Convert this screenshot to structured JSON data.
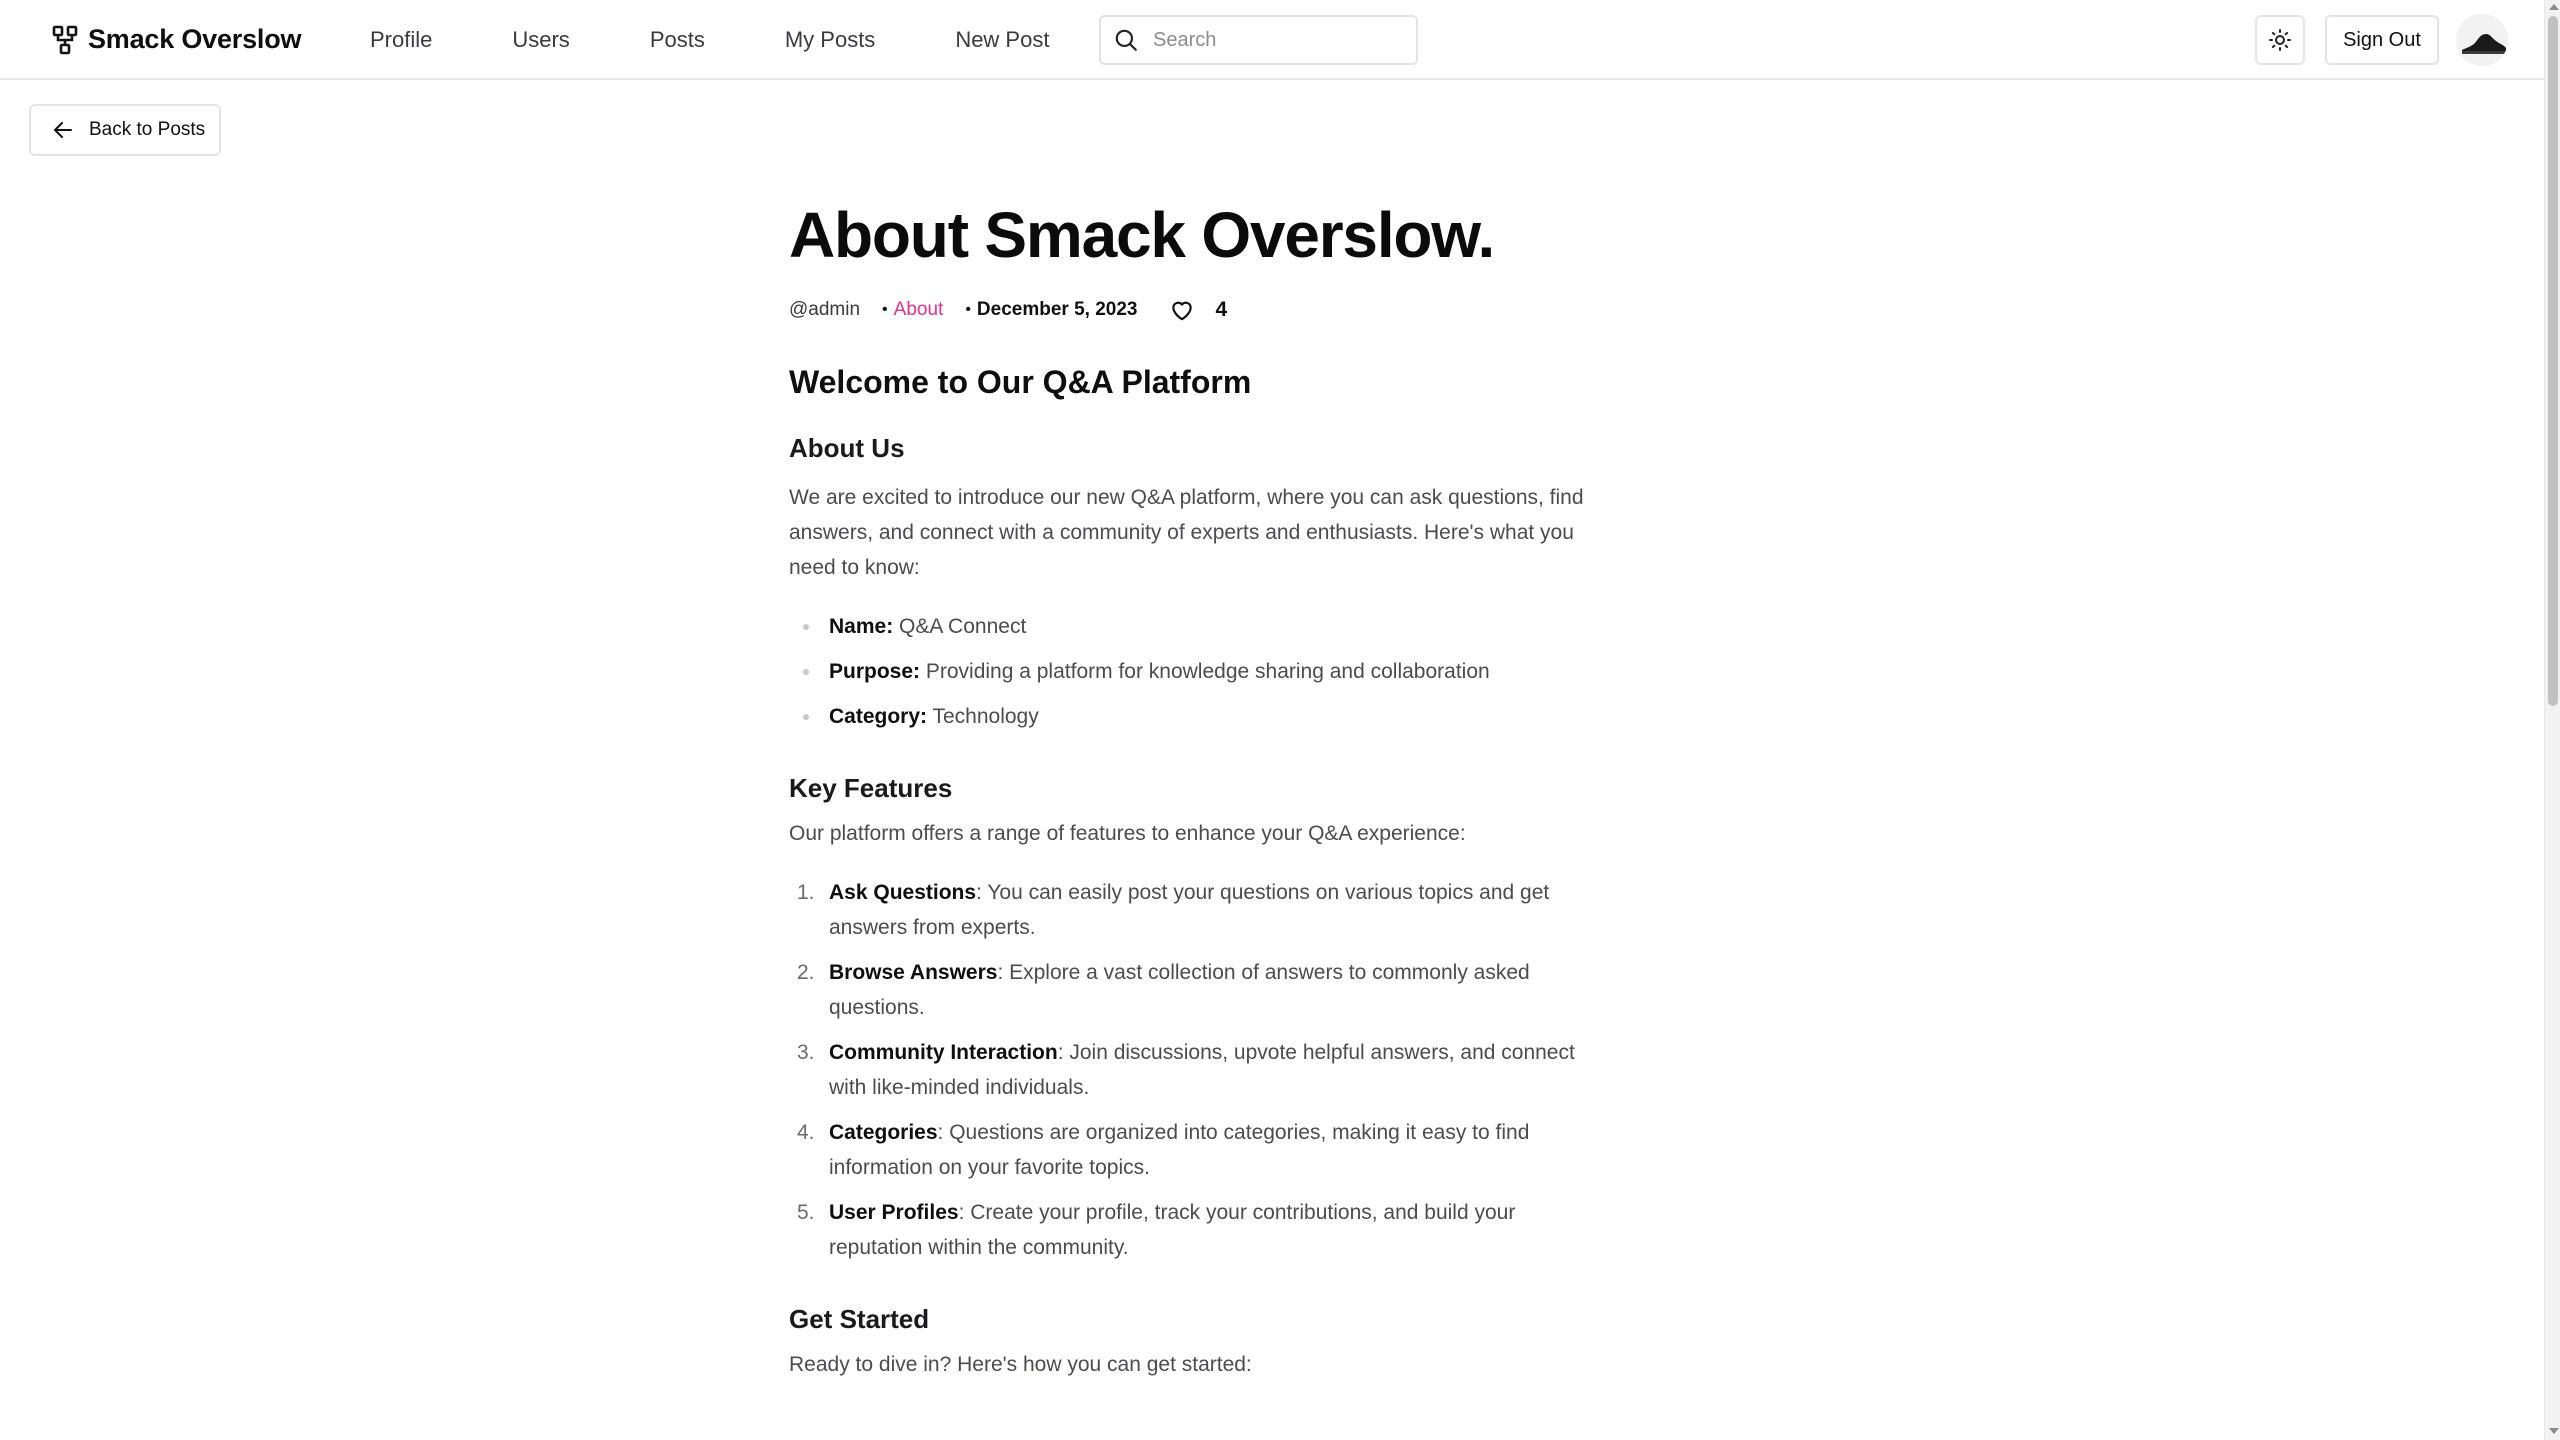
{
  "header": {
    "brand": "Smack Overslow",
    "nav": [
      "Profile",
      "Users",
      "Posts",
      "My Posts",
      "New Post"
    ],
    "search_placeholder": "Search",
    "signout_label": "Sign Out"
  },
  "back_label": "Back to Posts",
  "post": {
    "title": "About Smack Overslow.",
    "author": "@admin",
    "category": "About",
    "date": "December 5, 2023",
    "likes": "4",
    "h_welcome": "Welcome to Our Q&A Platform",
    "h_about": "About Us",
    "intro": "We are excited to introduce our new Q&A platform, where you can ask questions, find answers, and connect with a community of experts and enthusiasts. Here's what you need to know:",
    "facts": [
      {
        "label": "Name:",
        "value": " Q&A Connect"
      },
      {
        "label": "Purpose:",
        "value": " Providing a platform for knowledge sharing and collaboration"
      },
      {
        "label": "Category:",
        "value": " Technology"
      }
    ],
    "h_features": "Key Features",
    "features_intro": "Our platform offers a range of features to enhance your Q&A experience:",
    "features": [
      {
        "num": "1.",
        "label": "Ask Questions",
        "value": ": You can easily post your questions on various topics and get answers from experts."
      },
      {
        "num": "2.",
        "label": "Browse Answers",
        "value": ": Explore a vast collection of answers to commonly asked questions."
      },
      {
        "num": "3.",
        "label": "Community Interaction",
        "value": ": Join discussions, upvote helpful answers, and connect with like-minded individuals."
      },
      {
        "num": "4.",
        "label": "Categories",
        "value": ": Questions are organized into categories, making it easy to find information on your favorite topics."
      },
      {
        "num": "5.",
        "label": "User Profiles",
        "value": ": Create your profile, track your contributions, and build your reputation within the community."
      }
    ],
    "h_started": "Get Started",
    "started_intro": "Ready to dive in? Here's how you can get started:"
  },
  "colors": {
    "accent_category": "#e4308a",
    "text": "#0f0f10",
    "muted": "#4b4b52",
    "border": "#e4e4e7"
  },
  "icons": [
    "logo-icon",
    "search-icon",
    "sun-icon",
    "arrow-left-icon",
    "heart-icon",
    "avatar-icon"
  ]
}
